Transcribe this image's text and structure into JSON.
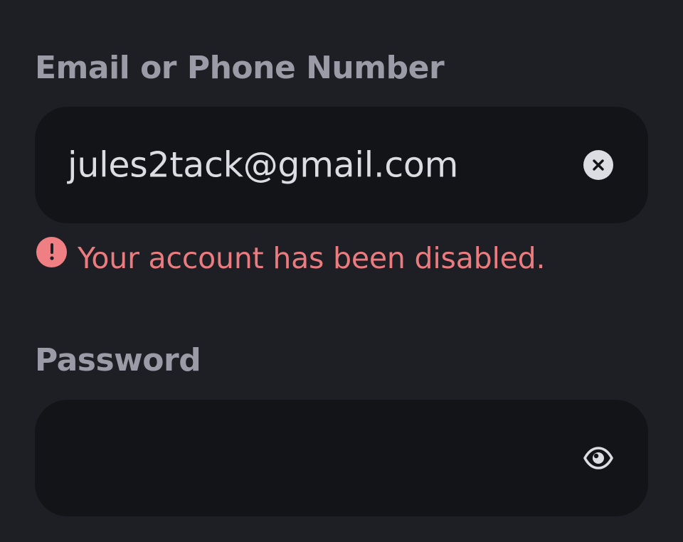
{
  "colors": {
    "background": "#1e1f24",
    "input_background": "#131418",
    "label": "#9a9ba6",
    "input_text": "#dcdde2",
    "error": "#ea7c80"
  },
  "email_field": {
    "label": "Email or Phone Number",
    "value": "jules2tack@gmail.com",
    "clear_icon": "clear-circle-x-icon"
  },
  "error": {
    "icon": "exclamation-circle-icon",
    "message": "Your account has been disabled."
  },
  "password_field": {
    "label": "Password",
    "value": "",
    "visibility_icon": "eye-icon"
  }
}
